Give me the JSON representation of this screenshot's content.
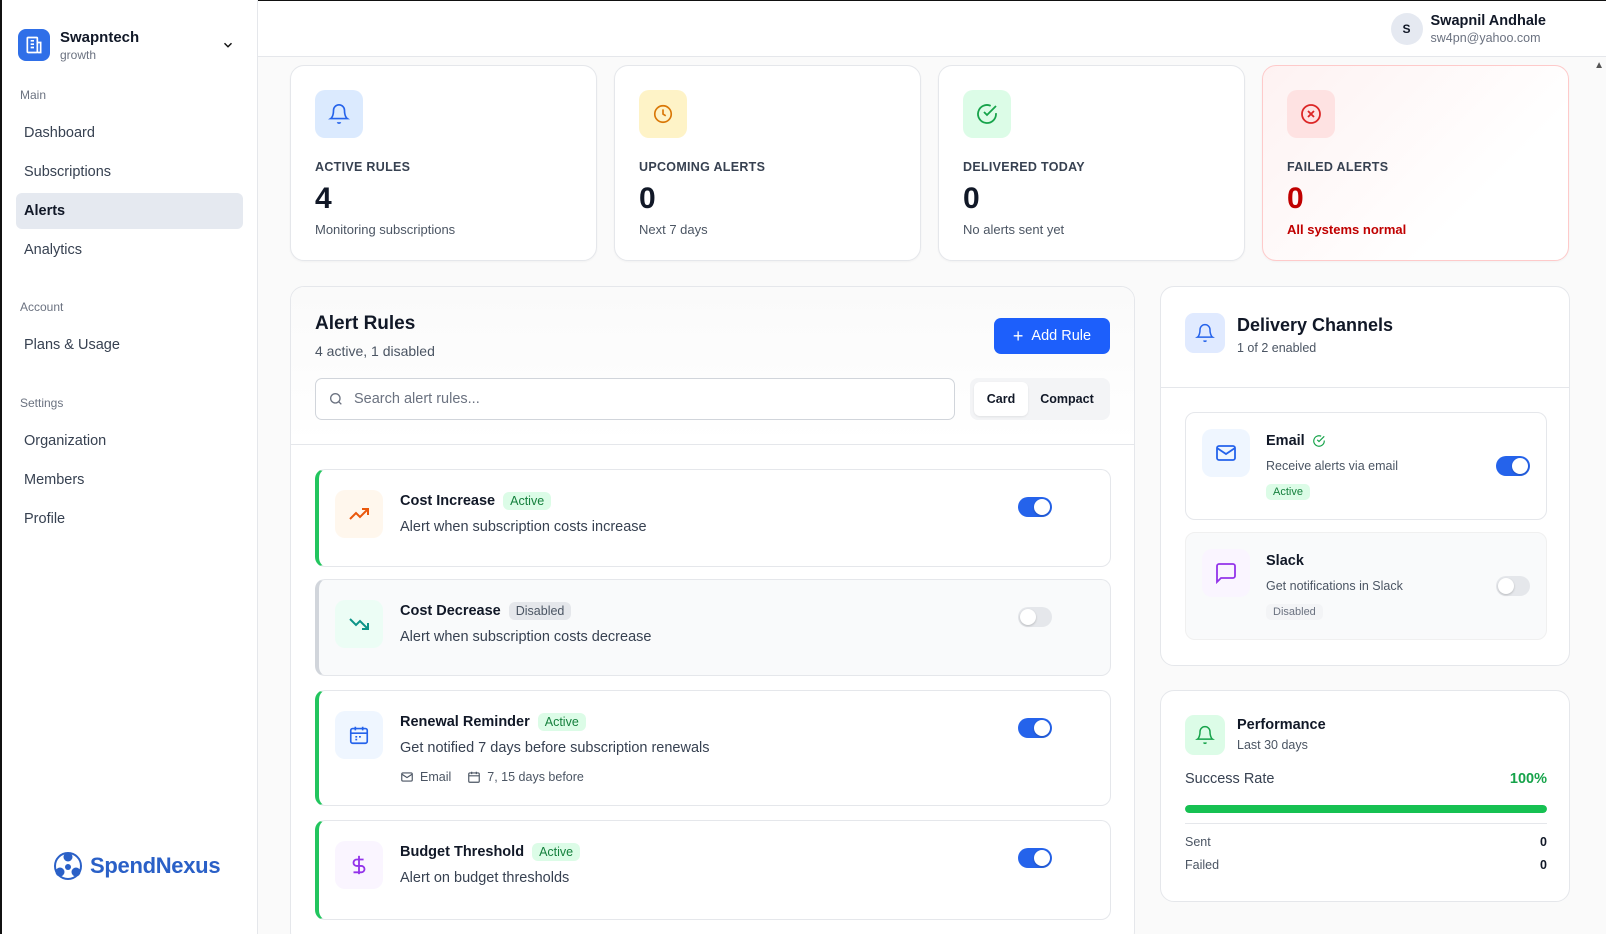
{
  "org": {
    "name": "Swapntech",
    "plan": "growth"
  },
  "sidebar": {
    "sections": [
      {
        "title": "Main",
        "items": [
          "Dashboard",
          "Subscriptions",
          "Alerts",
          "Analytics"
        ]
      },
      {
        "title": "Account",
        "items": [
          "Plans & Usage"
        ]
      },
      {
        "title": "Settings",
        "items": [
          "Organization",
          "Members",
          "Profile"
        ]
      }
    ],
    "active_item": "Alerts"
  },
  "brand": {
    "name": "SpendNexus"
  },
  "user": {
    "initial": "S",
    "name": "Swapnil Andhale",
    "email": "sw4pn@yahoo.com"
  },
  "stats": [
    {
      "label": "ACTIVE RULES",
      "value": "4",
      "sub": "Monitoring subscriptions",
      "icon": "bell-icon",
      "color": "#2563eb"
    },
    {
      "label": "UPCOMING ALERTS",
      "value": "0",
      "sub": "Next 7 days",
      "icon": "clock-icon",
      "color": "#d97706"
    },
    {
      "label": "DELIVERED TODAY",
      "value": "0",
      "sub": "No alerts sent yet",
      "icon": "check-circle-icon",
      "color": "#16a34a"
    },
    {
      "label": "FAILED ALERTS",
      "value": "0",
      "sub": "All systems normal",
      "icon": "x-circle-icon",
      "color": "#dc2626"
    }
  ],
  "alert_rules": {
    "title": "Alert Rules",
    "subtitle": "4 active, 1 disabled",
    "add_label": "Add Rule",
    "search_placeholder": "Search alert rules...",
    "view_options": [
      "Card",
      "Compact"
    ],
    "view_selected": "Card",
    "rules": [
      {
        "title": "Cost Increase",
        "status": "Active",
        "desc": "Alert when subscription costs increase",
        "enabled": true,
        "icon": "trending-up-icon"
      },
      {
        "title": "Cost Decrease",
        "status": "Disabled",
        "desc": "Alert when subscription costs decrease",
        "enabled": false,
        "icon": "trending-down-icon"
      },
      {
        "title": "Renewal Reminder",
        "status": "Active",
        "desc": "Get notified 7 days before subscription renewals",
        "enabled": true,
        "icon": "calendar-icon",
        "meta": {
          "channel": "Email",
          "days": "7, 15 days before"
        }
      },
      {
        "title": "Budget Threshold",
        "status": "Active",
        "desc": "Alert on budget thresholds",
        "enabled": true,
        "icon": "dollar-icon"
      }
    ]
  },
  "channels": {
    "title": "Delivery Channels",
    "subtitle": "1 of 2 enabled",
    "items": [
      {
        "name": "Email",
        "desc": "Receive alerts via email",
        "status": "Active",
        "enabled": true,
        "icon": "mail-icon"
      },
      {
        "name": "Slack",
        "desc": "Get notifications in Slack",
        "status": "Disabled",
        "enabled": false,
        "icon": "message-icon"
      }
    ]
  },
  "performance": {
    "title": "Performance",
    "subtitle": "Last 30 days",
    "success_label": "Success Rate",
    "success_value": "100%",
    "success_fraction": 1.0,
    "sent_label": "Sent",
    "sent_value": "0",
    "failed_label": "Failed",
    "failed_value": "0"
  }
}
